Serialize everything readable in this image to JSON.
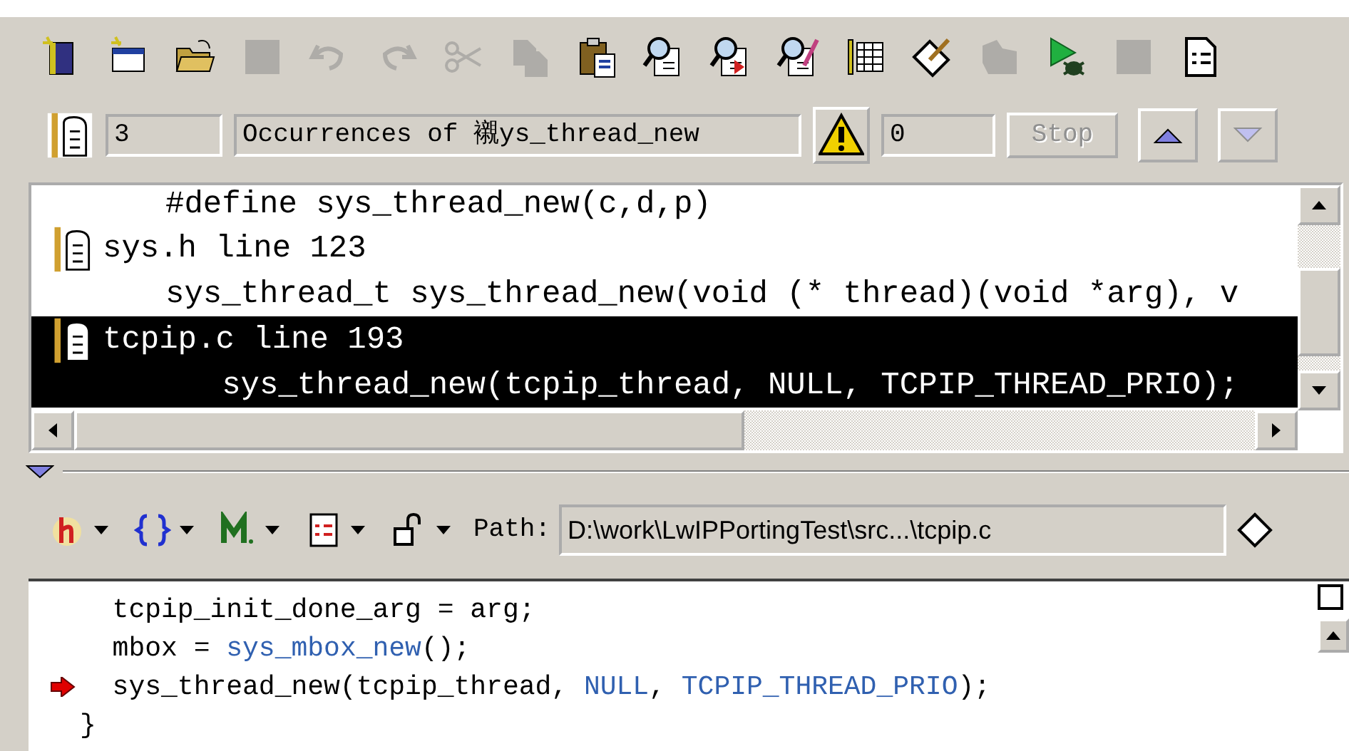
{
  "toolbar": {
    "buttons": [
      {
        "kind": "new-file",
        "disabled": false
      },
      {
        "kind": "new-window",
        "disabled": false
      },
      {
        "kind": "open",
        "disabled": false
      },
      {
        "kind": "save",
        "disabled": true
      },
      {
        "kind": "undo",
        "disabled": true
      },
      {
        "kind": "redo",
        "disabled": true
      },
      {
        "kind": "cut",
        "disabled": true
      },
      {
        "kind": "copy",
        "disabled": true
      },
      {
        "kind": "paste",
        "disabled": false
      },
      {
        "kind": "search",
        "disabled": false
      },
      {
        "kind": "search-next",
        "disabled": false
      },
      {
        "kind": "search-edit",
        "disabled": false
      },
      {
        "kind": "list",
        "disabled": false
      },
      {
        "kind": "tag",
        "disabled": false
      },
      {
        "kind": "shape",
        "disabled": true
      },
      {
        "kind": "run",
        "disabled": false
      },
      {
        "kind": "save",
        "disabled": true
      },
      {
        "kind": "document",
        "disabled": false
      }
    ]
  },
  "search_bar": {
    "count": "3",
    "query": "Occurrences of 襯ys_thread_new",
    "warnings": "0",
    "stop": {
      "label": "Stop",
      "disabled": true
    },
    "prev": {
      "disabled": false
    },
    "next": {
      "disabled": true
    }
  },
  "results": {
    "entries": [
      {
        "code": "#define sys_thread_new(c,d,p)",
        "selected": false
      },
      {
        "title": "sys.h line 123",
        "code": "sys_thread_t sys_thread_new(void (* thread)(void *arg), v",
        "selected": false
      },
      {
        "title": "tcpip.c line 193",
        "code": "   sys_thread_new(tcpip_thread, NULL, TCPIP_THREAD_PRIO);",
        "selected": true
      }
    ]
  },
  "editor_toolbar": {
    "path_label": "Path:",
    "path": "D:\\work\\LwIPPortingTest\\src...\\tcpip.c"
  },
  "code": {
    "lines": [
      {
        "segments": [
          {
            "kind": "plain",
            "text": "  tcpip_init_done_arg = arg;"
          }
        ]
      },
      {
        "segments": [
          {
            "kind": "plain",
            "text": "  mbox = "
          },
          {
            "kind": "symbol",
            "text": "sys_mbox_new"
          },
          {
            "kind": "plain",
            "text": "();"
          }
        ]
      },
      {
        "current": true,
        "segments": [
          {
            "kind": "plain",
            "text": "  sys_thread_new(tcpip_thread, "
          },
          {
            "kind": "symbol",
            "text": "NULL"
          },
          {
            "kind": "plain",
            "text": ", "
          },
          {
            "kind": "symbol",
            "text": "TCPIP_THREAD_PRIO"
          },
          {
            "kind": "plain",
            "text": ");"
          }
        ]
      },
      {
        "segments": [
          {
            "kind": "plain",
            "text": "}"
          }
        ]
      }
    ]
  }
}
